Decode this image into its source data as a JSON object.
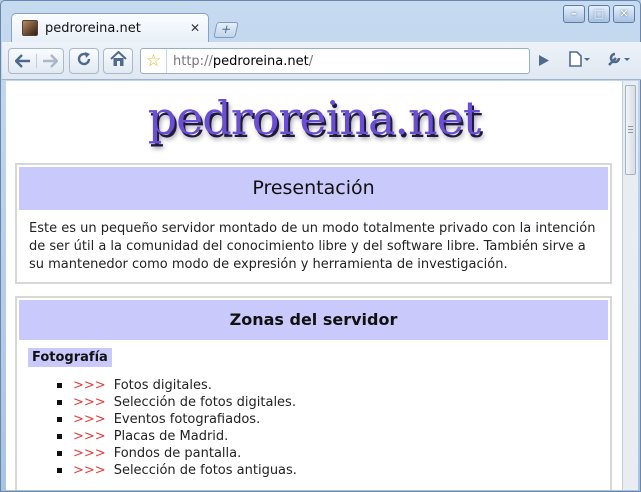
{
  "browser": {
    "tab_title": "pedroreina.net",
    "tab_close": "✕",
    "new_tab": "+",
    "url_scheme": "http://",
    "url_host": "pedroreina.net",
    "url_path": "/",
    "window_buttons": {
      "minimize": "–",
      "maximize": "□",
      "close": "✕"
    }
  },
  "page": {
    "logo_text": "pedroreina.net",
    "presentation": {
      "heading": "Presentación",
      "text": "Este es un pequeño servidor montado de un modo totalmente privado con la intención de ser útil a la comunidad del conocimiento libre y del software libre. También sirve a su mantenedor como modo de expresión y herramienta de investigación."
    },
    "zones": {
      "heading": "Zonas del servidor",
      "category": "Fotografía",
      "arrows": ">>>",
      "items": [
        "Fotos digitales.",
        "Selección de fotos digitales.",
        "Eventos fotografiados.",
        "Placas de Madrid.",
        "Fondos de pantalla.",
        "Selección de fotos antiguas."
      ]
    }
  },
  "icons": {
    "back": "back-arrow-icon",
    "forward": "forward-arrow-icon",
    "reload": "reload-icon",
    "home": "home-icon",
    "bookmark": "star-icon",
    "go": "play-icon",
    "page_menu": "page-icon",
    "tools_menu": "wrench-icon"
  },
  "colors": {
    "heading_bg": "#c9c9fb",
    "logo": "#6a4fd2",
    "arrows": "#e53b3b"
  }
}
